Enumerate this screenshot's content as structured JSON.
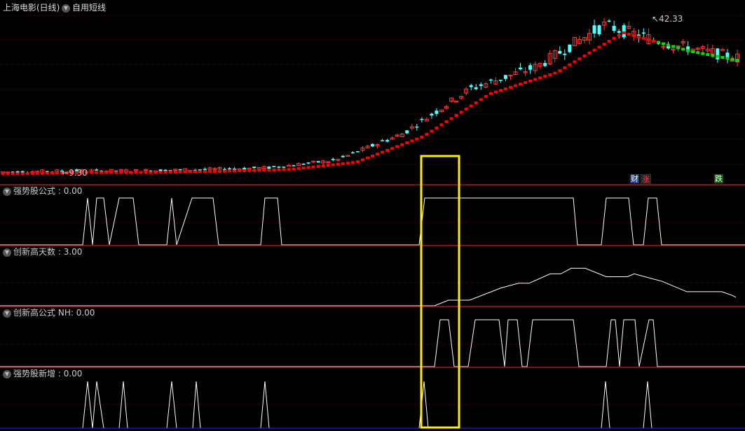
{
  "header": {
    "stock_title": "上海电影(日线)",
    "formula_name": "自用短线",
    "price_high": "42.33",
    "price_low": "9.30"
  },
  "badges": {
    "cai": "财",
    "zhang": "涨",
    "die": "跌"
  },
  "panels": [
    {
      "title": "强势股公式",
      "value": ": 0.00"
    },
    {
      "title": "创新高天数",
      "value": ": 3.00"
    },
    {
      "title": "创新高公式",
      "value": "NH: 0.00"
    },
    {
      "title": "强势股新增",
      "value": ": 0.00"
    }
  ],
  "colors": {
    "background": "#000000",
    "up": "#ff3b3b",
    "down": "#54ffff",
    "dots_up": "#ff0000",
    "dots_down": "#00dd00",
    "signal_line": "#ffffff",
    "highlight_box": "#ffee00",
    "divider": "#b01515"
  },
  "chart_data": {
    "type": "candlestick",
    "ylim": [
      9.3,
      42.33
    ],
    "price_line_y_anchors": [
      9.3,
      9.6,
      9.6,
      9.9,
      10.3,
      12.0,
      18.0,
      28.0,
      33.0,
      42.33,
      38.0,
      35.0
    ],
    "signal_panels": [
      {
        "name": "强势股公式",
        "type": "step",
        "values": [
          0,
          1,
          0,
          1,
          0,
          1,
          0,
          1,
          0,
          1,
          0,
          1,
          0,
          1,
          0,
          1,
          0
        ]
      },
      {
        "name": "创新高天数",
        "type": "line",
        "values": [
          0,
          0,
          0,
          0,
          0,
          0,
          0,
          1,
          1,
          3,
          4,
          4,
          5,
          6,
          7,
          7,
          6,
          6,
          6,
          5,
          4,
          4,
          3
        ]
      },
      {
        "name": "创新高公式",
        "type": "step",
        "values": [
          0,
          1,
          0,
          1,
          0,
          1,
          0,
          1,
          0,
          1,
          0,
          1,
          0,
          1,
          0
        ]
      },
      {
        "name": "强势股新增",
        "type": "pulse",
        "values": [
          0,
          1,
          0,
          1,
          0,
          1,
          0,
          1,
          0,
          1,
          0,
          1,
          0,
          1,
          0,
          1,
          0,
          1,
          0
        ]
      }
    ]
  }
}
